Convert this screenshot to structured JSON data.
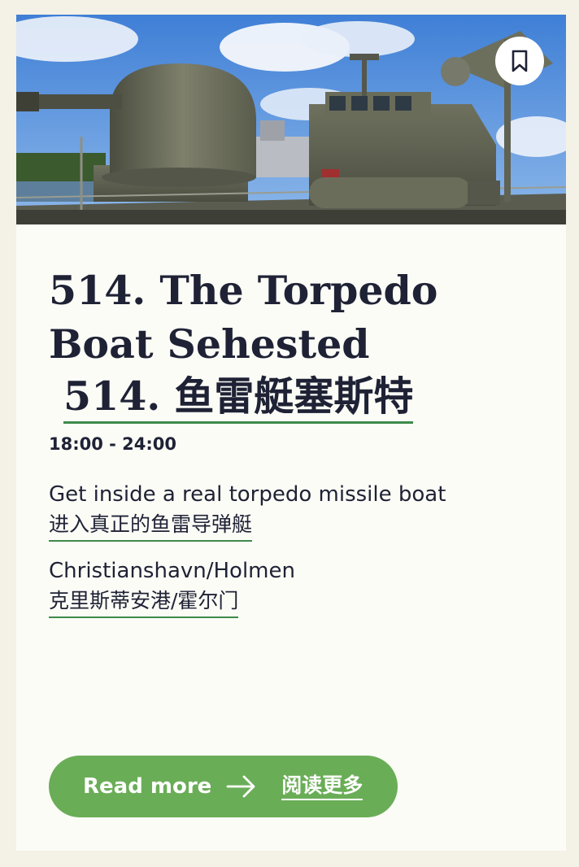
{
  "card": {
    "image_alt": "Torpedo boat Sehested deck with gun turret",
    "bookmark_icon": "bookmark-icon",
    "title": "514. The Torpedo Boat Sehested",
    "title_cn": "514. 鱼雷艇塞斯特",
    "time": "18:00 - 24:00",
    "description": "Get inside a real torpedo missile boat",
    "description_cn": "进入真正的鱼雷导弹艇",
    "location": "Christianshavn/Holmen",
    "location_cn": "克里斯蒂安港/霍尔门",
    "read_more_label": "Read more",
    "read_more_icon": "arrow-right-icon",
    "read_more_cn": "阅读更多"
  },
  "colors": {
    "page_background": "#f4f1e6",
    "card_background": "#fbfcf6",
    "text": "#1f2235",
    "accent_green": "#6aad57",
    "underline_green": "#3e8a4a"
  }
}
